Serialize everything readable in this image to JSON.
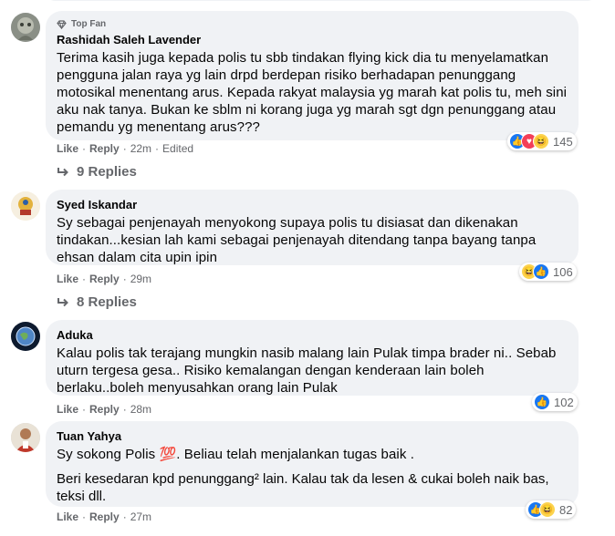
{
  "comments": [
    {
      "badge": "Top Fan",
      "name": "Rashidah Saleh Lavender",
      "text": "Terima kasih juga kepada polis tu sbb tindakan flying kick dia tu menyelamatkan pengguna jalan raya yg lain drpd berdepan risiko berhadapan penunggang motosikal menentang arus. Kepada rakyat malaysia yg marah kat polis tu, meh sini aku nak tanya. Bukan ke sblm ni korang juga yg marah sgt dgn penunggang atau pemandu yg menentang arus???",
      "like": "Like",
      "reply": "Reply",
      "time": "22m",
      "edited": "Edited",
      "reactions": [
        "like-icon",
        "love-icon",
        "haha-icon"
      ],
      "count": "145",
      "replies": "9 Replies"
    },
    {
      "name": "Syed Iskandar",
      "text": "Sy sebagai penjenayah menyokong supaya polis tu disiasat dan dikenakan tindakan...kesian lah kami sebagai penjenayah ditendang tanpa bayang tanpa ehsan dalam cita upin ipin",
      "like": "Like",
      "reply": "Reply",
      "time": "29m",
      "reactions": [
        "haha-icon",
        "like-icon"
      ],
      "count": "106",
      "replies": "8 Replies"
    },
    {
      "name": "Aduka",
      "text": "Kalau polis tak terajang mungkin nasib malang lain Pulak timpa brader ni.. Sebab uturn tergesa gesa.. Risiko kemalangan dengan kenderaan lain boleh berlaku..boleh menyusahkan orang lain Pulak",
      "like": "Like",
      "reply": "Reply",
      "time": "28m",
      "reactions": [
        "like-icon"
      ],
      "count": "102"
    },
    {
      "name": "Tuan Yahya",
      "text": "Sy sokong Polis 💯. Beliau telah menjalankan tugas baik .",
      "text2": "Beri kesedaran kpd penunggang² lain. Kalau tak da lesen & cukai boleh naik bas, teksi dll.",
      "like": "Like",
      "reply": "Reply",
      "time": "27m",
      "reactions": [
        "like-icon",
        "haha-icon"
      ],
      "count": "82"
    }
  ]
}
